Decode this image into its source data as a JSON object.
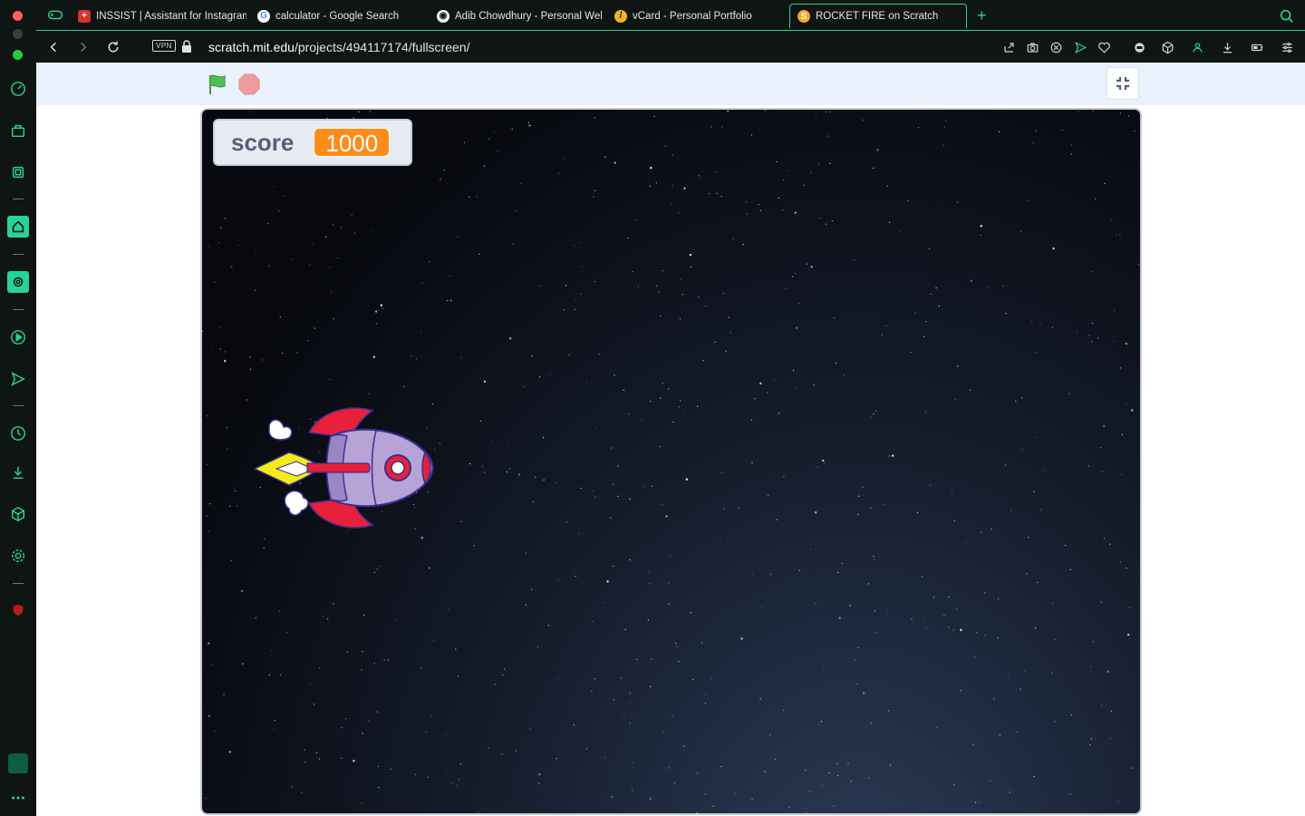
{
  "browser": {
    "tabs": [
      {
        "label": "INSSIST | Assistant for Instagram",
        "favicon": "plus-box-icon",
        "favicon_color": "#d2342f"
      },
      {
        "label": "calculator - Google Search",
        "favicon": "google-icon",
        "favicon_color": "#ffffff"
      },
      {
        "label": "Adib Chowdhury - Personal Website",
        "favicon": "globe-icon",
        "favicon_color": "#ffffff"
      },
      {
        "label": "vCard - Personal Portfolio",
        "favicon": "vcard-icon",
        "favicon_color": "#f2b51e"
      },
      {
        "label": "ROCKET FIRE on Scratch",
        "favicon": "scratch-icon",
        "favicon_color": "#f6a623",
        "active": true
      }
    ],
    "new_tab_label": "+",
    "address": {
      "vpn_label": "VPN",
      "url_host": "scratch.mit.edu",
      "url_path": "/projects/494117174/fullscreen/"
    },
    "accent_color": "#2bd19b"
  },
  "scratch": {
    "monitor": {
      "label": "score",
      "value": "1000"
    },
    "controls": {
      "green_flag": "green-flag-icon",
      "stop": "stop-icon",
      "unfullscreen": "unfullscreen-icon"
    },
    "sprite": "rocket"
  }
}
